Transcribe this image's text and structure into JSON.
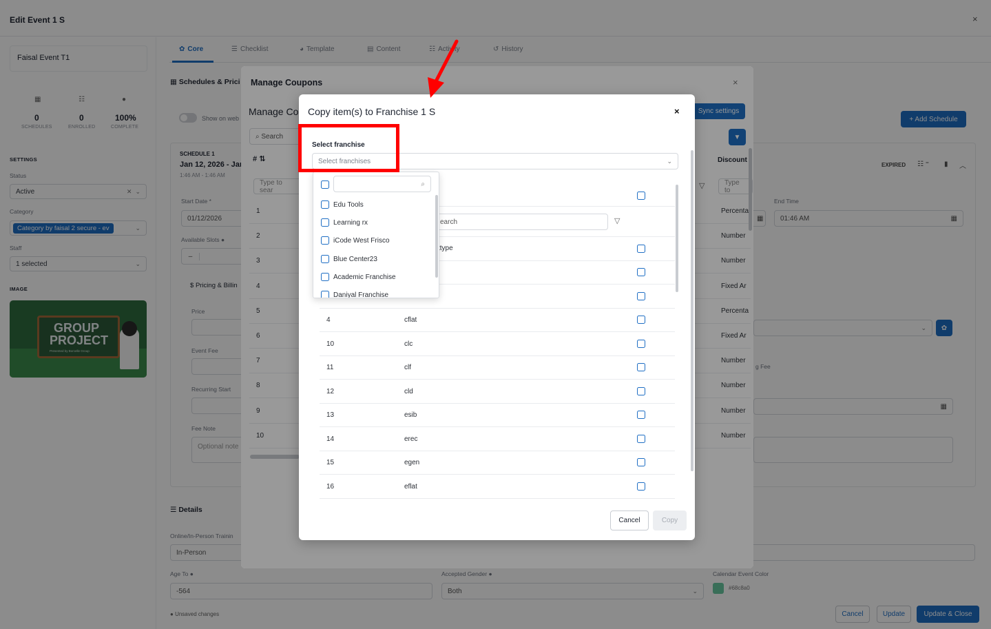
{
  "outer": {
    "title": "Edit Event 1 S",
    "close": "×",
    "event_name": "Faisal Event T1",
    "stats": [
      {
        "icon": "calendar-icon",
        "value": "0",
        "label": "SCHEDULES"
      },
      {
        "icon": "users-icon",
        "value": "0",
        "label": "ENROLLED"
      },
      {
        "icon": "check-circle-icon",
        "value": "100%",
        "label": "COMPLETE"
      }
    ],
    "settings_label": "SETTINGS",
    "status_label": "Status",
    "status_value": "Active",
    "category_label": "Category",
    "category_value": "Category by faisal 2 secure - ev",
    "staff_label": "Staff",
    "staff_value": "1 selected",
    "image_label": "IMAGE",
    "image_text_1": "GROUP",
    "image_text_2": "PROJECT",
    "image_text_3": "Presented by Borcelle Group",
    "tabs": [
      {
        "label": "Core",
        "icon": "gear-icon"
      },
      {
        "label": "Checklist",
        "icon": "list-icon"
      },
      {
        "label": "Template",
        "icon": "palette-icon"
      },
      {
        "label": "Content",
        "icon": "document-icon"
      },
      {
        "label": "Activity",
        "icon": "users-icon"
      },
      {
        "label": "History",
        "icon": "history-icon"
      }
    ],
    "schedules_title": "Schedules & Prici",
    "show_on_web": "Show on web",
    "add_schedule": "+ Add Schedule",
    "schedule_label": "SCHEDULE 1",
    "schedule_date": "Jan 12, 2026 - Jan",
    "schedule_time": "1:46 AM - 1:46 AM",
    "expired": "EXPIRED",
    "start_date_label": "Start Date *",
    "start_date_value": "01/12/2026",
    "end_time_label": "End Time",
    "end_time_value": "01:46 AM",
    "available_slots": "Available Slots",
    "pricing_billing": "Pricing & Billin",
    "price": "Price",
    "event_fee": "Event Fee",
    "recurring_start": "Recurring Start",
    "fee_note": "Fee Note",
    "fee_note_placeholder": "Optional note",
    "recurring_fee_fragment": "g Fee",
    "details_title": "Details",
    "online_label": "Online/In-Person Trainin",
    "online_value": "In-Person",
    "age_to_label": "Age To",
    "age_to_value": "-564",
    "gender_label": "Accepted Gender",
    "gender_value": "Both",
    "color_label": "Calendar Event Color",
    "color_value": "#68c8a0",
    "unsaved": "Unsaved changes",
    "cancel": "Cancel",
    "update": "Update",
    "update_close": "Update & Close"
  },
  "coupons": {
    "title": "Manage Coupons",
    "close": "×",
    "subtitle": "Manage Co",
    "sync_settings": "Sync settings",
    "search_placeholder": "Search",
    "hash_header": "#",
    "discount_header": "Discount",
    "type_to_search": "Type to sear",
    "type_to_right": "Type to",
    "numbers": [
      "1",
      "2",
      "3",
      "4",
      "5",
      "6",
      "7",
      "8",
      "9",
      "10"
    ],
    "discounts": [
      "Percenta",
      "Number",
      "Number",
      "Fixed Ar",
      "Percenta",
      "Fixed Ar",
      "Number",
      "Number",
      "Number",
      "Number"
    ]
  },
  "copy": {
    "title": "Copy item(s) to Franchise 1 S",
    "close": "×",
    "select_label": "Select franchise",
    "select_placeholder": "Select franchises",
    "search_fragment": "earch",
    "header_fragment": "ttype",
    "franchises": [
      "Edu Tools",
      "Learning rx",
      "iCode West Frisco",
      "Blue Center23",
      "Academic Franchise",
      "Daniyal Franchise"
    ],
    "rows": [
      {
        "id": "4",
        "code": "cflat"
      },
      {
        "id": "10",
        "code": "clc"
      },
      {
        "id": "11",
        "code": "clf"
      },
      {
        "id": "12",
        "code": "cld"
      },
      {
        "id": "13",
        "code": "esib"
      },
      {
        "id": "14",
        "code": "erec"
      },
      {
        "id": "15",
        "code": "egen"
      },
      {
        "id": "16",
        "code": "eflat"
      }
    ],
    "cancel": "Cancel",
    "copy": "Copy"
  },
  "colors": {
    "accent": "#1e6ec4",
    "annotation": "#ff0000",
    "event_color": "#68c8a0"
  }
}
